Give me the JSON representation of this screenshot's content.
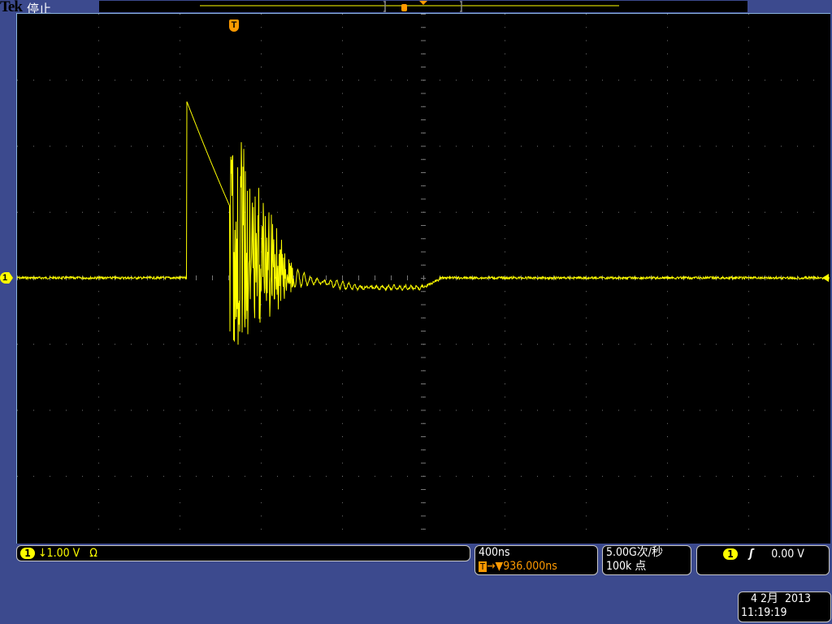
{
  "header": {
    "brand": "Tek",
    "state": "停止"
  },
  "trigger_marker": "T",
  "channel1": {
    "number": "1",
    "coupling_icon": "arrow-down",
    "scale": "↓1.00 V",
    "termination": "Ω",
    "color": "#ffff00"
  },
  "timebase": {
    "scale": "400ns",
    "trigger_icon": "T",
    "position": "→▼936.000ns"
  },
  "acquisition": {
    "sample_rate": "5.00G次/秒",
    "record_length": "100k 点"
  },
  "trigger": {
    "source": "1",
    "slope": "rising-edge",
    "level": "0.00 V"
  },
  "datetime": {
    "date": "4 2月  2013",
    "time": "11:19:19"
  },
  "colors": {
    "trace": "#ffff00",
    "trigger": "#ff9a00",
    "background": "#3c4a8e"
  }
}
